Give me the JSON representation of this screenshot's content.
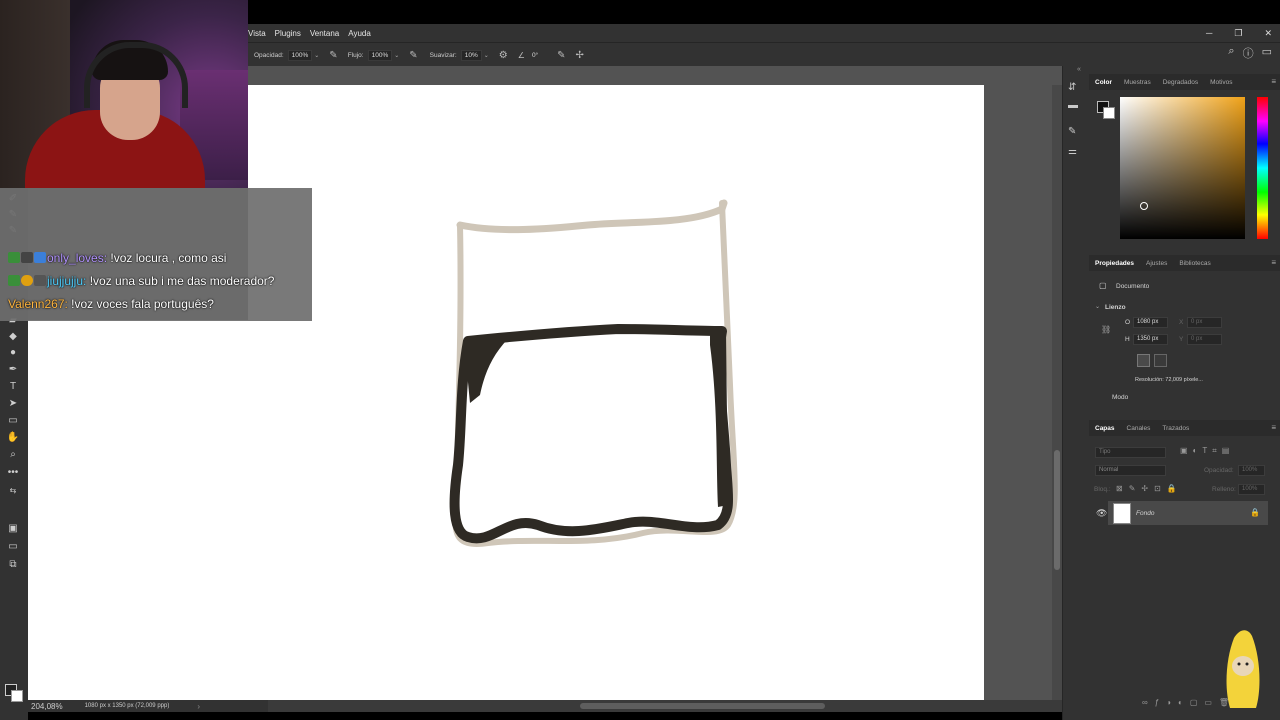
{
  "menu": {
    "items": [
      "Vista",
      "Plugins",
      "Ventana",
      "Ayuda"
    ],
    "window_controls": [
      "─",
      "❐",
      "✕"
    ]
  },
  "options_bar": {
    "opacity_label": "Opacidad:",
    "opacity_value": "100%",
    "flow_label": "Flujo:",
    "flow_value": "100%",
    "smoothing_label": "Suavizar:",
    "smoothing_value": "10%",
    "angle_value": "0°"
  },
  "status": {
    "zoom": "204,08%",
    "doc_info": "1080 px x 1350 px (72,009 ppp)"
  },
  "color_panel": {
    "tabs": [
      "Color",
      "Muestras",
      "Degradados",
      "Motivos"
    ],
    "active_tab": "Color",
    "hue_color": "#f0a218"
  },
  "properties_panel": {
    "tabs": [
      "Propiedades",
      "Ajustes",
      "Bibliotecas"
    ],
    "doc_label": "Documento",
    "section": "Lienzo",
    "width_label": "O",
    "width_value": "1080 px",
    "height_label": "H",
    "height_value": "1350 px",
    "x_label": "X",
    "x_placeholder": "0 px",
    "y_label": "Y",
    "y_placeholder": "0 px",
    "resolution": "Resolución: 72,009 píxele...",
    "mode_label": "Modo"
  },
  "layers_panel": {
    "tabs": [
      "Capas",
      "Canales",
      "Trazados"
    ],
    "search_placeholder": "Tipo",
    "blend_mode": "Normal",
    "opacity_label": "Opacidad:",
    "opacity_value": "100%",
    "lock_label": "Bloq.:",
    "fill_label": "Relleno:",
    "fill_value": "100%",
    "layer_name": "Fondo"
  },
  "chat": {
    "messages": [
      {
        "user": "only_loves:",
        "text": " !voz locura , como asi"
      },
      {
        "user": "jiujjujju:",
        "text": " !voz una sub i me das moderador?"
      },
      {
        "user": "Valenn267:",
        "text": " !voz voces fala português?"
      }
    ]
  },
  "colors": {
    "ui_bg": "#323232",
    "workspace": "#535353",
    "stroke_light": "#cfc6b8",
    "stroke_dark": "#2e2a24"
  }
}
